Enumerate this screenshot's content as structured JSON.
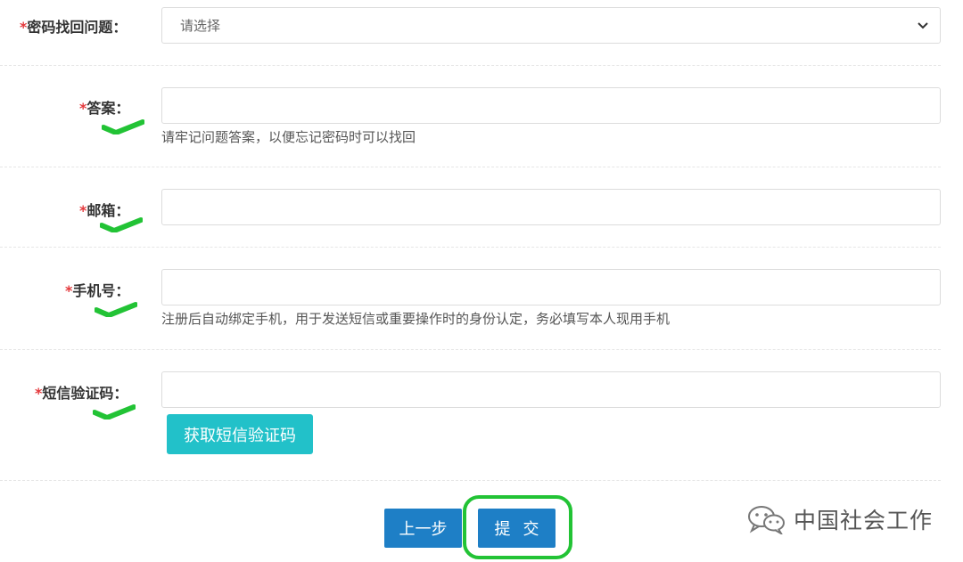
{
  "form": {
    "question": {
      "required_mark": "*",
      "label": "密码找回问题：",
      "selected": "请选择"
    },
    "answer": {
      "required_mark": "*",
      "label": "答案：",
      "hint": "请牢记问题答案，以便忘记密码时可以找回"
    },
    "email": {
      "required_mark": "*",
      "label": "邮箱："
    },
    "phone": {
      "required_mark": "*",
      "label": "手机号：",
      "hint": "注册后自动绑定手机，用于发送短信或重要操作时的身份认定，务必填写本人现用手机"
    },
    "sms_code": {
      "required_mark": "*",
      "label": "短信验证码：",
      "button_label": "获取短信验证码"
    }
  },
  "actions": {
    "prev_label": "上一步",
    "submit_label": "提交"
  },
  "watermark": {
    "text": "中国社会工作",
    "icon": "wechat-icon"
  },
  "colors": {
    "accent_blue": "#1e7fc6",
    "teal": "#22c1c9",
    "required_red": "#e4393c",
    "check_green": "#22c335"
  }
}
